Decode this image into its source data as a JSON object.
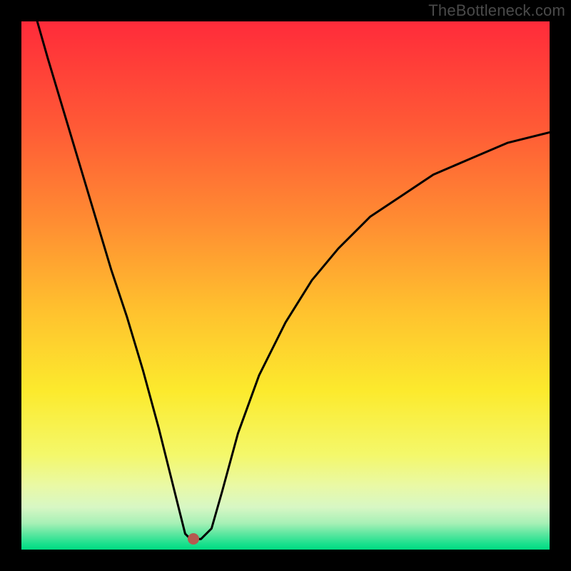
{
  "watermark": "TheBottleneck.com",
  "chart_data": {
    "type": "line",
    "title": "",
    "xlabel": "",
    "ylabel": "",
    "xlim": [
      0,
      100
    ],
    "ylim": [
      0,
      100
    ],
    "x": [
      3,
      5,
      8,
      11,
      14,
      17,
      20,
      23,
      26,
      28,
      30,
      31,
      32,
      32.5,
      34,
      36,
      38,
      41,
      45,
      50,
      55,
      60,
      66,
      72,
      78,
      85,
      92,
      100
    ],
    "y": [
      100,
      93,
      83,
      73,
      63,
      53,
      44,
      34,
      23,
      15,
      7,
      3,
      2,
      2,
      2,
      4,
      11,
      22,
      33,
      43,
      51,
      57,
      63,
      67,
      71,
      74,
      77,
      79
    ],
    "marker": {
      "x": 32.5,
      "y": 2
    },
    "gradient_stops": [
      {
        "pos": 0,
        "color": "#ff2b3a"
      },
      {
        "pos": 20,
        "color": "#ff5a36"
      },
      {
        "pos": 38,
        "color": "#ff8d32"
      },
      {
        "pos": 55,
        "color": "#ffc22e"
      },
      {
        "pos": 70,
        "color": "#fcea2d"
      },
      {
        "pos": 82,
        "color": "#f4f86a"
      },
      {
        "pos": 88,
        "color": "#e9f9a6"
      },
      {
        "pos": 92,
        "color": "#d7f7c4"
      },
      {
        "pos": 95,
        "color": "#a7f0b6"
      },
      {
        "pos": 97,
        "color": "#5ee7a0"
      },
      {
        "pos": 99,
        "color": "#17e08c"
      },
      {
        "pos": 100,
        "color": "#00db82"
      }
    ]
  },
  "colors": {
    "curve": "#000000",
    "marker": "#b6594f"
  }
}
